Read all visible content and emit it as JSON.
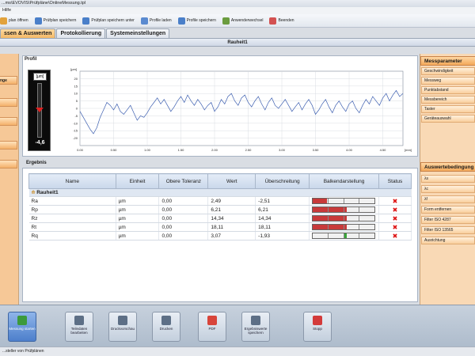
{
  "window": {
    "title": "...ms\\EVOVIS\\Prüfpläne\\OnlineMessung.tpl"
  },
  "menu": {
    "help": "Hilfe"
  },
  "toolbar": [
    {
      "label": "plan öffnen",
      "icon": "open-icon",
      "color": "#e2a23c"
    },
    {
      "label": "Prüfplan speichern",
      "icon": "save-icon",
      "color": "#4a7fc9"
    },
    {
      "label": "Prüfplan speichern unter",
      "icon": "save-as-icon",
      "color": "#4a7fc9"
    },
    {
      "label": "Profile laden",
      "icon": "load-icon",
      "color": "#5a8ad0"
    },
    {
      "label": "Profile speichern",
      "icon": "profile-save-icon",
      "color": "#4a7fc9"
    },
    {
      "label": "Anwenderwechsel",
      "icon": "user-switch-icon",
      "color": "#6b9c3f"
    },
    {
      "label": "Beenden",
      "icon": "exit-icon",
      "color": "#d35151"
    }
  ],
  "tabs": [
    {
      "label": "ssen & Auswerten",
      "active": true
    },
    {
      "label": "Protokollierung",
      "active": false
    },
    {
      "label": "Systemeinstellungen",
      "active": false
    }
  ],
  "subheader": "Rauheit1",
  "left_panel": [
    "nge",
    "",
    "",
    "",
    ""
  ],
  "profil": {
    "title": "Profil",
    "gauge": {
      "unit": "[µm]",
      "value": "-4,6"
    },
    "chart_data": {
      "type": "line",
      "ylabel": "[µm]",
      "xlabel": "[mm]",
      "xlim": [
        0,
        4.8
      ],
      "ylim": [
        -25,
        25
      ],
      "xticks": [
        "0.00",
        "0.50",
        "1.00",
        "1.50",
        "2.00",
        "2.50",
        "3.00",
        "3.50",
        "4.00",
        "4.50"
      ],
      "yticks": [
        "20",
        "15",
        "10",
        "5",
        "0",
        "-5",
        "-10",
        "-15",
        "-20"
      ],
      "grid": true,
      "series": [
        {
          "values": [
            [
              0,
              -2
            ],
            [
              0.05,
              -6
            ],
            [
              0.1,
              -10
            ],
            [
              0.15,
              -14
            ],
            [
              0.2,
              -17
            ],
            [
              0.25,
              -13
            ],
            [
              0.3,
              -6
            ],
            [
              0.35,
              -1
            ],
            [
              0.4,
              4
            ],
            [
              0.45,
              2
            ],
            [
              0.5,
              -1
            ],
            [
              0.55,
              3
            ],
            [
              0.6,
              -2
            ],
            [
              0.65,
              -4
            ],
            [
              0.7,
              -1
            ],
            [
              0.75,
              2
            ],
            [
              0.8,
              -3
            ],
            [
              0.85,
              -8
            ],
            [
              0.9,
              -5
            ],
            [
              0.95,
              -6
            ],
            [
              1.0,
              -3
            ],
            [
              1.05,
              1
            ],
            [
              1.1,
              4
            ],
            [
              1.15,
              7
            ],
            [
              1.2,
              3
            ],
            [
              1.25,
              6
            ],
            [
              1.3,
              2
            ],
            [
              1.35,
              -2
            ],
            [
              1.4,
              1
            ],
            [
              1.45,
              5
            ],
            [
              1.5,
              8
            ],
            [
              1.55,
              4
            ],
            [
              1.6,
              9
            ],
            [
              1.65,
              5
            ],
            [
              1.7,
              2
            ],
            [
              1.75,
              6
            ],
            [
              1.8,
              3
            ],
            [
              1.85,
              -1
            ],
            [
              1.9,
              2
            ],
            [
              1.95,
              4
            ],
            [
              2.0,
              -2
            ],
            [
              2.05,
              1
            ],
            [
              2.1,
              6
            ],
            [
              2.15,
              3
            ],
            [
              2.2,
              8
            ],
            [
              2.25,
              10
            ],
            [
              2.3,
              5
            ],
            [
              2.35,
              2
            ],
            [
              2.4,
              7
            ],
            [
              2.45,
              9
            ],
            [
              2.5,
              4
            ],
            [
              2.55,
              1
            ],
            [
              2.6,
              5
            ],
            [
              2.65,
              8
            ],
            [
              2.7,
              3
            ],
            [
              2.75,
              -1
            ],
            [
              2.8,
              4
            ],
            [
              2.85,
              7
            ],
            [
              2.9,
              2
            ],
            [
              2.95,
              0
            ],
            [
              3.0,
              3
            ],
            [
              3.05,
              6
            ],
            [
              3.1,
              2
            ],
            [
              3.15,
              -2
            ],
            [
              3.2,
              1
            ],
            [
              3.25,
              4
            ],
            [
              3.3,
              -1
            ],
            [
              3.35,
              3
            ],
            [
              3.4,
              6
            ],
            [
              3.45,
              2
            ],
            [
              3.5,
              -4
            ],
            [
              3.55,
              -1
            ],
            [
              3.6,
              3
            ],
            [
              3.65,
              6
            ],
            [
              3.7,
              1
            ],
            [
              3.75,
              -3
            ],
            [
              3.8,
              2
            ],
            [
              3.85,
              5
            ],
            [
              3.9,
              1
            ],
            [
              3.95,
              -2
            ],
            [
              4.0,
              3
            ],
            [
              4.05,
              5
            ],
            [
              4.1,
              0
            ],
            [
              4.15,
              -3
            ],
            [
              4.2,
              2
            ],
            [
              4.25,
              6
            ],
            [
              4.3,
              3
            ],
            [
              4.35,
              8
            ],
            [
              4.4,
              5
            ],
            [
              4.45,
              2
            ],
            [
              4.5,
              7
            ],
            [
              4.55,
              10
            ],
            [
              4.6,
              5
            ],
            [
              4.65,
              9
            ],
            [
              4.7,
              12
            ],
            [
              4.75,
              8
            ],
            [
              4.8,
              10
            ]
          ]
        }
      ]
    }
  },
  "ergebnis": {
    "title": "Ergebnis",
    "columns": [
      "Name",
      "Einheit",
      "Obere Toleranz",
      "Wert",
      "Überschreitung",
      "Balkendarstellung",
      "Status"
    ],
    "group": "Rauheit1",
    "rows": [
      {
        "name": "Ra",
        "unit": "µm",
        "tol": "0,00",
        "value": "2,49",
        "exceed": "-2,51",
        "bar_fill": 0.24,
        "bar_color": "#c83a3a"
      },
      {
        "name": "Rp",
        "unit": "µm",
        "tol": "0,00",
        "value": "6,21",
        "exceed": "6,21",
        "bar_fill": 0.54,
        "bar_color": "#c83a3a"
      },
      {
        "name": "Rz",
        "unit": "µm",
        "tol": "0,00",
        "value": "14,34",
        "exceed": "14,34",
        "bar_fill": 0.54,
        "bar_color": "#c83a3a"
      },
      {
        "name": "Rt",
        "unit": "µm",
        "tol": "0,00",
        "value": "18,11",
        "exceed": "18,11",
        "bar_fill": 0.54,
        "bar_color": "#c83a3a"
      },
      {
        "name": "Rq",
        "unit": "µm",
        "tol": "0,00",
        "value": "3,07",
        "exceed": "-1,93",
        "bar_fill": 0.05,
        "bar_color": "#3aa63a"
      }
    ]
  },
  "right_panel": {
    "messparameter": {
      "title": "Messparameter",
      "items": [
        "Geschwindigkeit",
        "Messweg",
        "Punktabstand",
        "Messbereich",
        "Taster",
        "Geräteauswahl"
      ]
    },
    "auswertung": {
      "title": "Auswertebedingung",
      "items": [
        "λs",
        "λc",
        "λf",
        "Form entfernen",
        "Filter ISO 4287",
        "Filter ISO 13565",
        "Ausrichtung"
      ]
    }
  },
  "bottom_buttons": [
    {
      "label": "Messung starten",
      "icon": "start-icon",
      "color": "#3c9a3c"
    },
    {
      "label": "Teiledaten bearbeiten",
      "icon": "edit-data-icon",
      "color": "#5d6f86"
    },
    {
      "label": "Druckvorschau",
      "icon": "print-preview-icon",
      "color": "#5d6f86"
    },
    {
      "label": "Drucken",
      "icon": "print-icon",
      "color": "#5d6f86"
    },
    {
      "label": "PDF",
      "icon": "pdf-icon",
      "color": "#d8453b"
    },
    {
      "label": "Ergebniswerte speichern",
      "icon": "save-results-icon",
      "color": "#5d6f86"
    },
    {
      "label": "Stopp",
      "icon": "stop-icon",
      "color": "#d33a3a"
    }
  ],
  "statusbar": "...steller von Prüfplänen"
}
